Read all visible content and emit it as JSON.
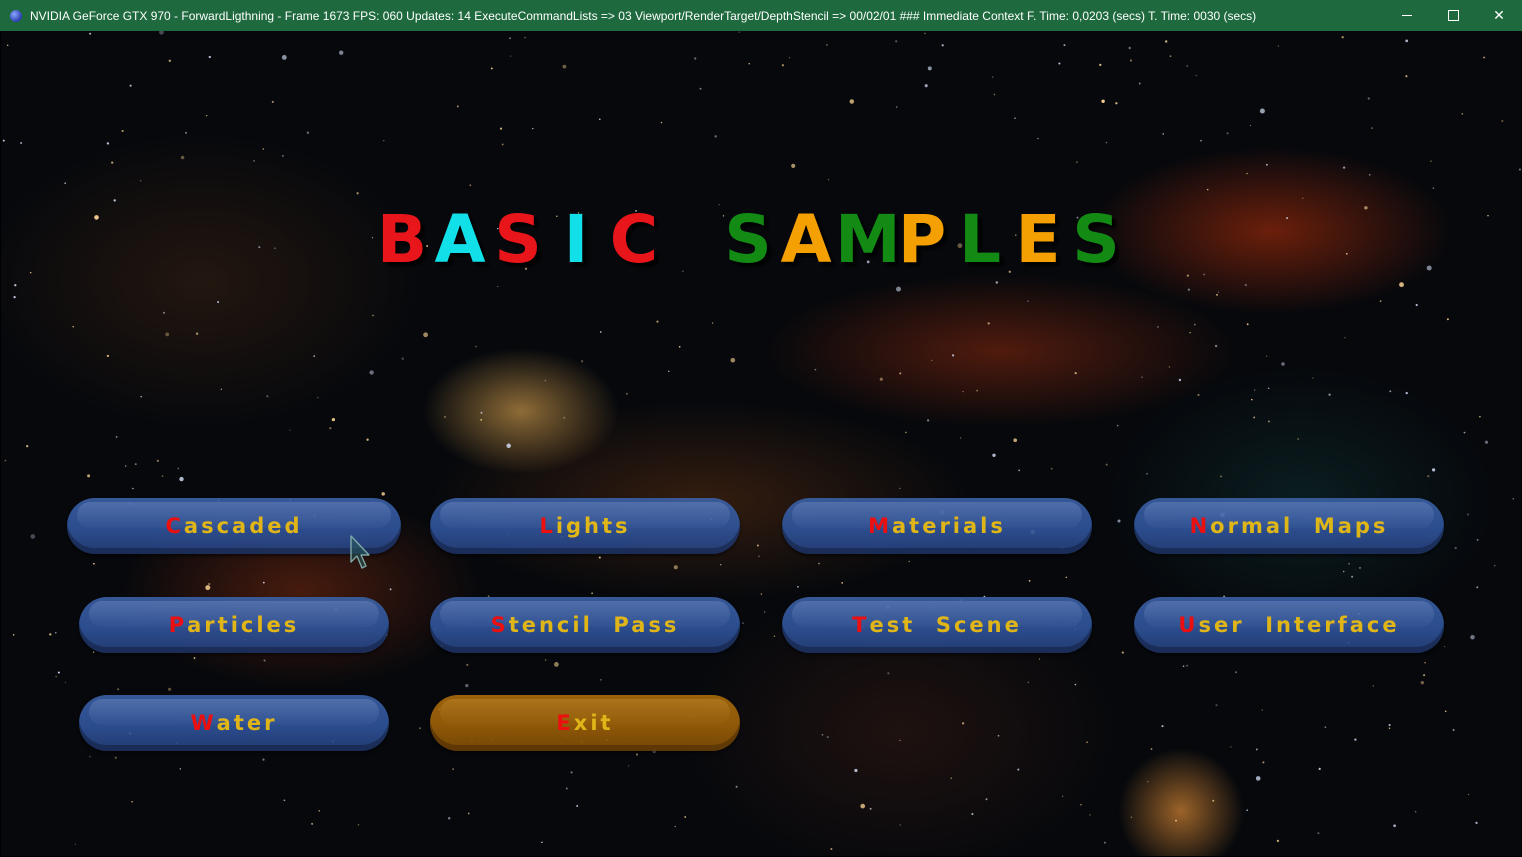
{
  "window": {
    "title": "NVIDIA GeForce GTX 970 - ForwardLigthning - Frame 1673 FPS: 060 Updates: 14 ExecuteCommandLists => 03 Viewport/RenderTarget/DepthStencil => 00/02/01 ### Immediate Context F. Time: 0,0203 (secs) T. Time: 0030 (secs)",
    "titlebar_color": "#1e6a3e",
    "controls": {
      "minimize_icon": "minimize-icon",
      "maximize_icon": "maximize-icon",
      "close_label": "✕"
    }
  },
  "logo": {
    "letters": [
      {
        "char": "B",
        "color": "#e8151a"
      },
      {
        "char": "A",
        "color": "#12e0e8"
      },
      {
        "char": "S",
        "color": "#e8151a"
      },
      {
        "char": "I",
        "color": "#12e0e8"
      },
      {
        "char": "C",
        "color": "#e8151a"
      },
      {
        "char": " ",
        "color": ""
      },
      {
        "char": "S",
        "color": "#138a14"
      },
      {
        "char": "A",
        "color": "#f5a002"
      },
      {
        "char": "M",
        "color": "#138a14"
      },
      {
        "char": "P",
        "color": "#f5a002"
      },
      {
        "char": "L",
        "color": "#138a14"
      },
      {
        "char": "E",
        "color": "#f5a002"
      },
      {
        "char": "S",
        "color": "#138a14"
      }
    ]
  },
  "menu": {
    "buttons": [
      {
        "first": "C",
        "rest": "ascaded"
      },
      {
        "first": "L",
        "rest": "ights"
      },
      {
        "first": "M",
        "rest": "aterials"
      },
      {
        "first": "N",
        "rest": "ormal  Maps"
      },
      {
        "first": "P",
        "rest": "articles"
      },
      {
        "first": "S",
        "rest": "tencil  Pass"
      },
      {
        "first": "T",
        "rest": "est  Scene"
      },
      {
        "first": "U",
        "rest": "ser  Interface"
      },
      {
        "first": "W",
        "rest": "ater"
      },
      {
        "first": "E",
        "rest": "xit"
      }
    ],
    "label_color": "#f2c418",
    "accent_letter_color": "#ff1010",
    "button_color": "#2f5399",
    "exit_button_color": "#9a5f08"
  }
}
